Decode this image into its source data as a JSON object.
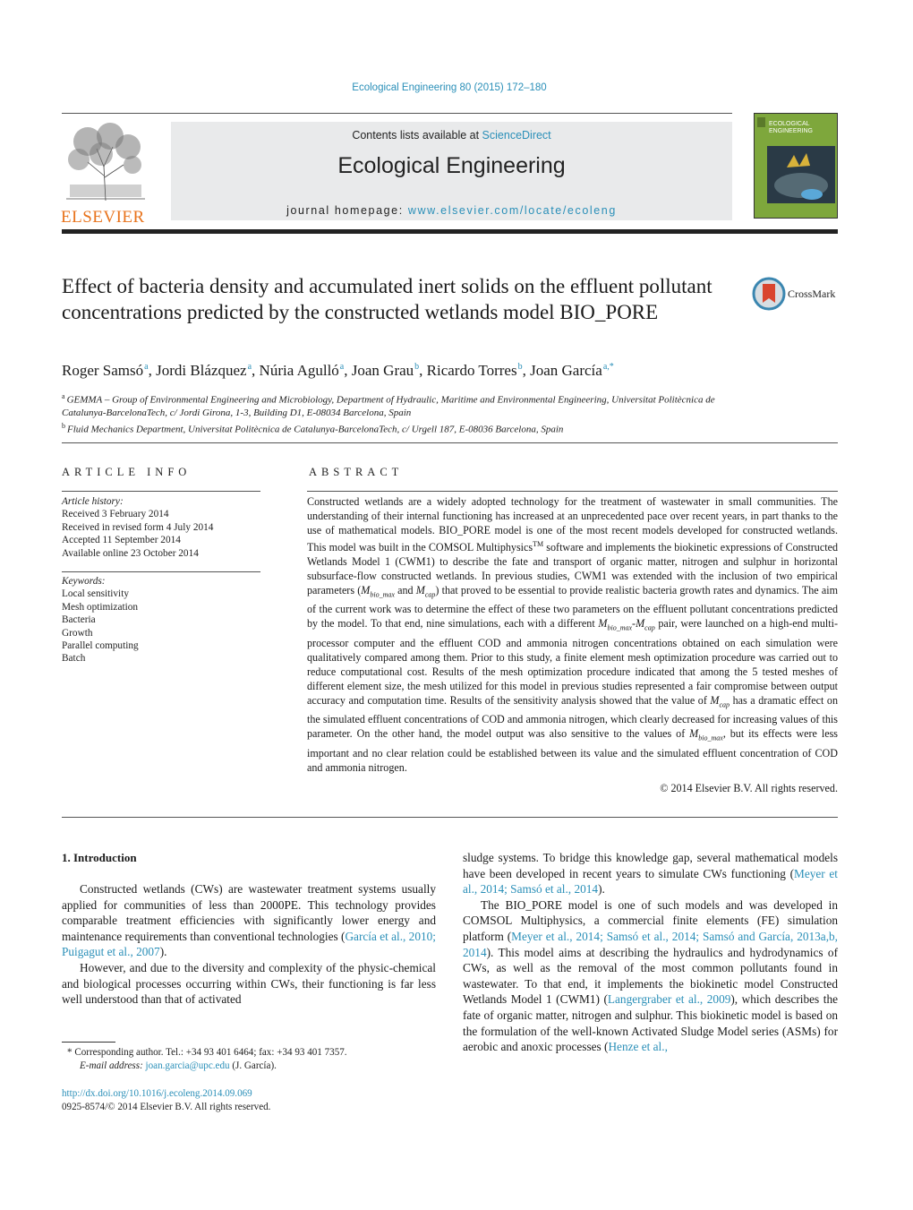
{
  "journal_citation": "Ecological Engineering 80 (2015) 172–180",
  "header": {
    "publisher_logo_text": "ELSEVIER",
    "contents_prefix": "Contents lists available at ",
    "contents_link": "ScienceDirect",
    "journal_title": "Ecological Engineering",
    "homepage_prefix": "journal homepage: ",
    "homepage_link": "www.elsevier.com/locate/ecoleng",
    "cover_title_line1": "ECOLOGICAL",
    "cover_title_line2": "ENGINEERING"
  },
  "article": {
    "title": "Effect of bacteria density and accumulated inert solids on the effluent pollutant concentrations predicted by the constructed wetlands model BIO_PORE",
    "crossmark_label": "CrossMark",
    "authors": [
      {
        "name": "Roger Samsó",
        "sup": "a"
      },
      {
        "name": "Jordi Blázquez",
        "sup": "a"
      },
      {
        "name": "Núria Agulló",
        "sup": "a"
      },
      {
        "name": "Joan Grau",
        "sup": "b"
      },
      {
        "name": "Ricardo Torres",
        "sup": "b"
      },
      {
        "name": "Joan García",
        "sup": "a,*"
      }
    ],
    "affiliations": [
      {
        "mark": "a",
        "text": "GEMMA – Group of Environmental Engineering and Microbiology, Department of Hydraulic, Maritime and Environmental Engineering, Universitat Politècnica de Catalunya-BarcelonaTech, c/ Jordi Girona, 1-3, Building D1, E-08034 Barcelona, Spain"
      },
      {
        "mark": "b",
        "text": "Fluid Mechanics Department, Universitat Politècnica de Catalunya-BarcelonaTech, c/ Urgell 187, E-08036 Barcelona, Spain"
      }
    ]
  },
  "article_info": {
    "heading": "ARTICLE INFO",
    "history_label": "Article history:",
    "history": [
      "Received 3 February 2014",
      "Received in revised form 4 July 2014",
      "Accepted 11 September 2014",
      "Available online 23 October 2014"
    ],
    "keywords_label": "Keywords:",
    "keywords": [
      "Local sensitivity",
      "Mesh optimization",
      "Bacteria",
      "Growth",
      "Parallel computing",
      "Batch"
    ]
  },
  "abstract": {
    "heading": "ABSTRACT",
    "part1": "Constructed wetlands are a widely adopted technology for the treatment of wastewater in small communities. The understanding of their internal functioning has increased at an unprecedented pace over recent years, in part thanks to the use of mathematical models. BIO_PORE model is one of the most recent models developed for constructed wetlands. This model was built in the COMSOL Multiphysics",
    "tm": "TM",
    "part2": " software and implements the biokinetic expressions of Constructed Wetlands Model 1 (CWM1) to describe the fate and transport of organic matter, nitrogen and sulphur in horizontal subsurface-flow constructed wetlands. In previous studies, CWM1 was extended with the inclusion of two empirical parameters (",
    "m": "M",
    "sub_biomax": "bio_max",
    "sub_cap": "cap",
    "and": " and ",
    "part3": ") that proved to be essential to provide realistic bacteria growth rates and dynamics. The aim of the current work was to determine the effect of these two parameters on the effluent pollutant concentrations predicted by the model. To that end, nine simulations, each with a different ",
    "dash": "-",
    "part4": " pair, were launched on a high-end multi-processor computer and the effluent COD and ammonia nitrogen concentrations obtained on each simulation were qualitatively compared among them. Prior to this study, a finite element mesh optimization procedure was carried out to reduce computational cost. Results of the mesh optimization procedure indicated that among the 5 tested meshes of different element size, the mesh utilized for this model in previous studies represented a fair compromise between output accuracy and computation time. Results of the sensitivity analysis showed that the value of ",
    "part5": " has a dramatic effect on the simulated effluent concentrations of COD and ammonia nitrogen, which clearly decreased for increasing values of this parameter. On the other hand, the model output was also sensitive to the values of ",
    "part6": ", but its effects were less important and no clear relation could be established between its value and the simulated effluent concentration of COD and ammonia nitrogen.",
    "copyright": "© 2014 Elsevier B.V. All rights reserved."
  },
  "introduction": {
    "heading": "1.  Introduction",
    "p1_text": "Constructed wetlands (CWs) are wastewater treatment systems usually applied for communities of less than 2000PE. This technology provides comparable treatment efficiencies with significantly lower energy and maintenance requirements than conventional technologies (",
    "p1_cite": "García et al., 2010; Puigagut et al., 2007",
    "p1_end": ").",
    "p2_text": "However, and due to the diversity and complexity of the physic-chemical and biological processes occurring within CWs, their functioning is far less well understood than that of activated",
    "p2_cont": "sludge systems. To bridge this knowledge gap, several mathematical models have been developed in recent years to simulate CWs functioning (",
    "p2_cite": "Meyer et al., 2014; Samsó et al., 2014",
    "p2_end": ").",
    "p3_text": "The BIO_PORE model is one of such models and was developed in COMSOL Multiphysics, a commercial finite elements (FE) simulation platform (",
    "p3_cite": "Meyer et al., 2014; Samsó et al., 2014; Samsó and García, 2013a,b, 2014",
    "p3_mid": "). This model aims at describing the hydraulics and hydrodynamics of CWs, as well as the removal of the most common pollutants found in wastewater. To that end, it implements the biokinetic model Constructed Wetlands Model 1 (CWM1) (",
    "p3_cite2": "Langergraber et al., 2009",
    "p3_mid2": "), which describes the fate of organic matter, nitrogen and sulphur. This biokinetic model is based on the formulation of the well-known Activated Sludge Model series (ASMs) for aerobic and anoxic processes (",
    "p3_cite3": "Henze et al.,"
  },
  "footnote": {
    "star": "*",
    "corresponding": " Corresponding author. Tel.: +34 93 401 6464; fax: +34 93 401 7357.",
    "email_label": "E-mail address: ",
    "email": "joan.garcia@upc.edu",
    "email_suffix": " (J. García).",
    "doi": "http://dx.doi.org/10.1016/j.ecoleng.2014.09.069",
    "issn": "0925-8574/© 2014 Elsevier B.V. All rights reserved."
  }
}
